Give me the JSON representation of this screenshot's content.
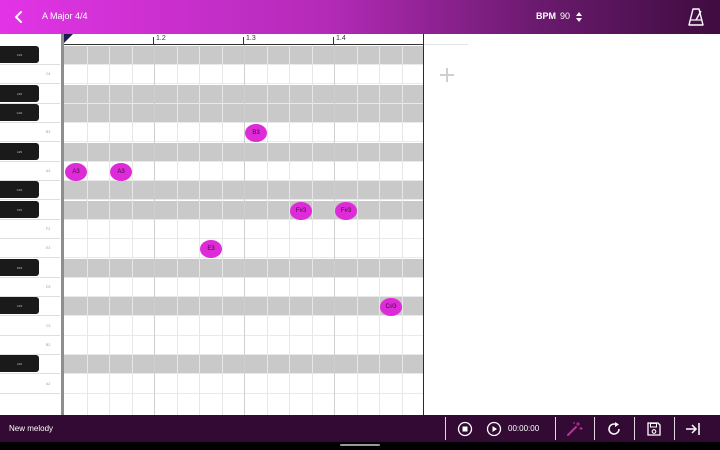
{
  "header": {
    "song_title": "A Major 4/4",
    "bpm_label": "BPM",
    "bpm_value": "90"
  },
  "ruler": {
    "measures": [
      "1.2",
      "1.3",
      "1.4"
    ]
  },
  "keys": [
    {
      "label": "C#4",
      "black": true
    },
    {
      "label": "C4",
      "black": false
    },
    {
      "label": "A#3",
      "black": true
    },
    {
      "label": "G#3",
      "black": true
    },
    {
      "label": "B3",
      "black": false
    },
    {
      "label": "A#3",
      "black": true
    },
    {
      "label": "A3",
      "black": false
    },
    {
      "label": "G#3",
      "black": true
    },
    {
      "label": "F#3",
      "black": true
    },
    {
      "label": "F3",
      "black": false
    },
    {
      "label": "E3",
      "black": false
    },
    {
      "label": "D#3",
      "black": true
    },
    {
      "label": "D3",
      "black": false
    },
    {
      "label": "C#3",
      "black": true
    },
    {
      "label": "C3",
      "black": false
    },
    {
      "label": "B2",
      "black": false
    },
    {
      "label": "A#2",
      "black": true
    },
    {
      "label": "A2",
      "black": false
    }
  ],
  "notes": [
    {
      "label": "B3",
      "pitch": "B3",
      "step": 8
    },
    {
      "label": "A3",
      "pitch": "A3",
      "step": 0
    },
    {
      "label": "A3",
      "pitch": "A3",
      "step": 2
    },
    {
      "label": "F#3",
      "pitch": "F#3",
      "step": 10
    },
    {
      "label": "F#3",
      "pitch": "F#3",
      "step": 12
    },
    {
      "label": "E3",
      "pitch": "E3",
      "step": 6
    },
    {
      "label": "C#3",
      "pitch": "C#3",
      "step": 14
    }
  ],
  "footer": {
    "melody_name": "New melody",
    "time": "00:00:00"
  },
  "colors": {
    "accent": "#dd2bd8",
    "header_start": "#e234e6",
    "header_end": "#3e0c3f",
    "footer_bg": "#320a33",
    "row_dark": "#c9c9c9",
    "wand_icon": "#c0309c"
  },
  "icons": {
    "back": "chevron-left-icon",
    "bpm_stepper": "up-down-arrows-icon",
    "metronome": "metronome-icon",
    "add": "plus-icon",
    "stop": "stop-icon",
    "play": "play-icon",
    "wand": "magic-wand-icon",
    "loop": "loop-icon",
    "save": "save-icon",
    "export": "export-icon"
  }
}
